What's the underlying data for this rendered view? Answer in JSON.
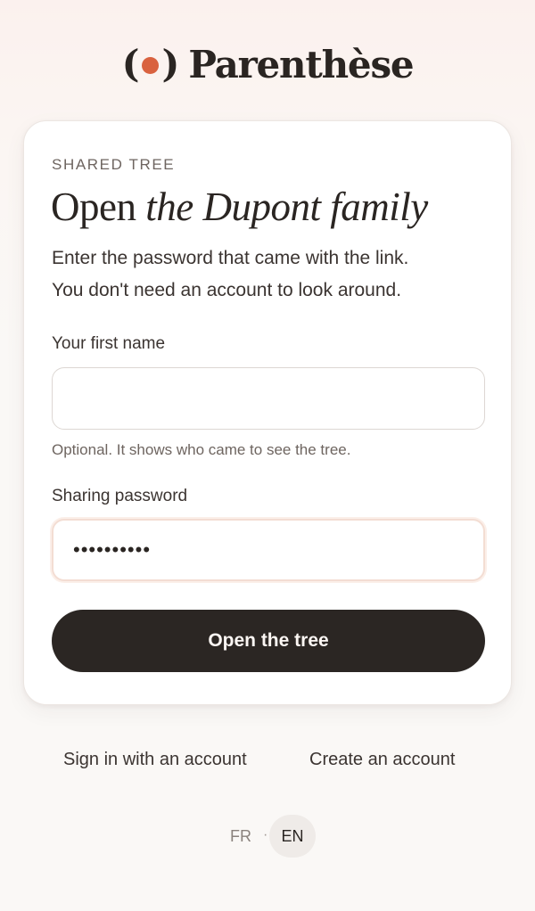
{
  "brand": {
    "paren_open": "(",
    "paren_close": ")",
    "name": "Parenthèse",
    "accent": "#d9623f"
  },
  "card": {
    "eyebrow": "SHARED TREE",
    "title_plain": "Open",
    "title_italic": "the Dupont family",
    "intro_line1": "Enter the password that came with the link.",
    "intro_line2": "You don't need an account to look around."
  },
  "form": {
    "first_name": {
      "label": "Your first name",
      "value": "",
      "hint": "Optional. It shows who came to see the tree."
    },
    "password": {
      "label": "Sharing password",
      "value_masked": "••••••••••"
    },
    "submit_label": "Open the tree"
  },
  "links": {
    "sign_in": "Sign in with an account",
    "create_account": "Create an account"
  },
  "language": {
    "fr": "FR",
    "separator": "·",
    "en": "EN",
    "selected": "EN"
  }
}
